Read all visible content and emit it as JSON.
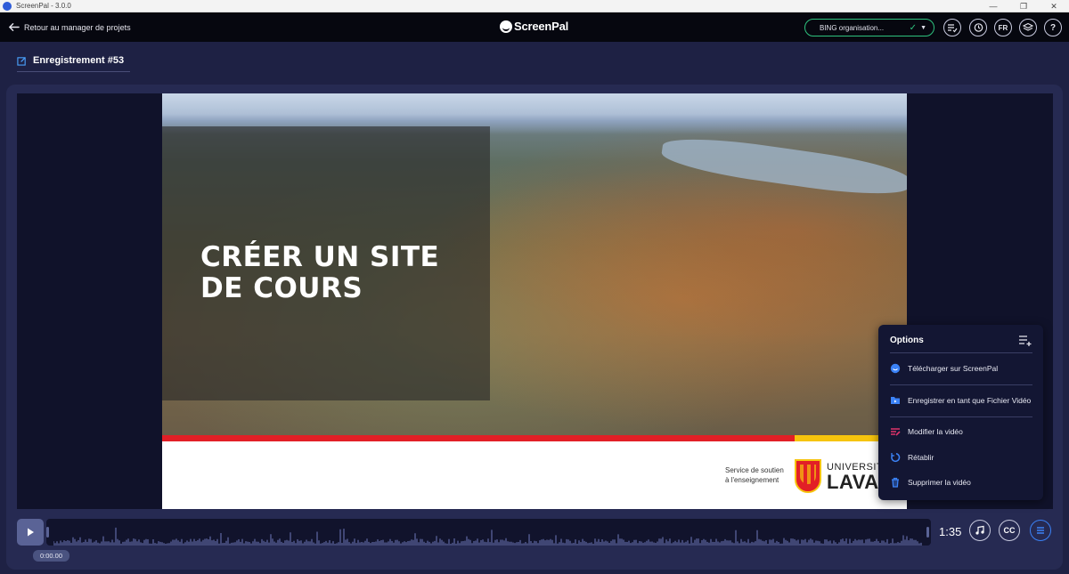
{
  "window": {
    "title": "ScreenPal - 3.0.0"
  },
  "header": {
    "back_label": "Retour au manager de projets",
    "brand": "ScreenPal",
    "org": "BING organisation...",
    "lang": "FR"
  },
  "project": {
    "title": "Enregistrement #53"
  },
  "video": {
    "title": "CRÉER UN SITE DE COURS",
    "subtitle_line1": "Service de soutien",
    "subtitle_line2": "à l'enseignement",
    "logo_line1": "UNIVERSITÉ",
    "logo_line2": "LAVAL"
  },
  "options": {
    "header": "Options",
    "items": [
      {
        "label": "Télécharger sur ScreenPal",
        "icon": "screenpal-upload-icon"
      },
      {
        "label": "Enregistrer en tant que Fichier Vidéo",
        "icon": "save-file-icon"
      },
      {
        "label": "Modifier la vidéo",
        "icon": "edit-video-icon"
      },
      {
        "label": "Rétablir",
        "icon": "restore-icon"
      },
      {
        "label": "Supprimer la vidéo",
        "icon": "trash-icon"
      }
    ]
  },
  "timeline": {
    "current_time": "0:00.00",
    "duration": "1:35",
    "cc_label": "CC"
  },
  "colors": {
    "accent_green": "#2ec27e",
    "accent_blue": "#3b82f6",
    "red_stripe": "#e21f26",
    "yellow_stripe": "#f6c40d"
  }
}
